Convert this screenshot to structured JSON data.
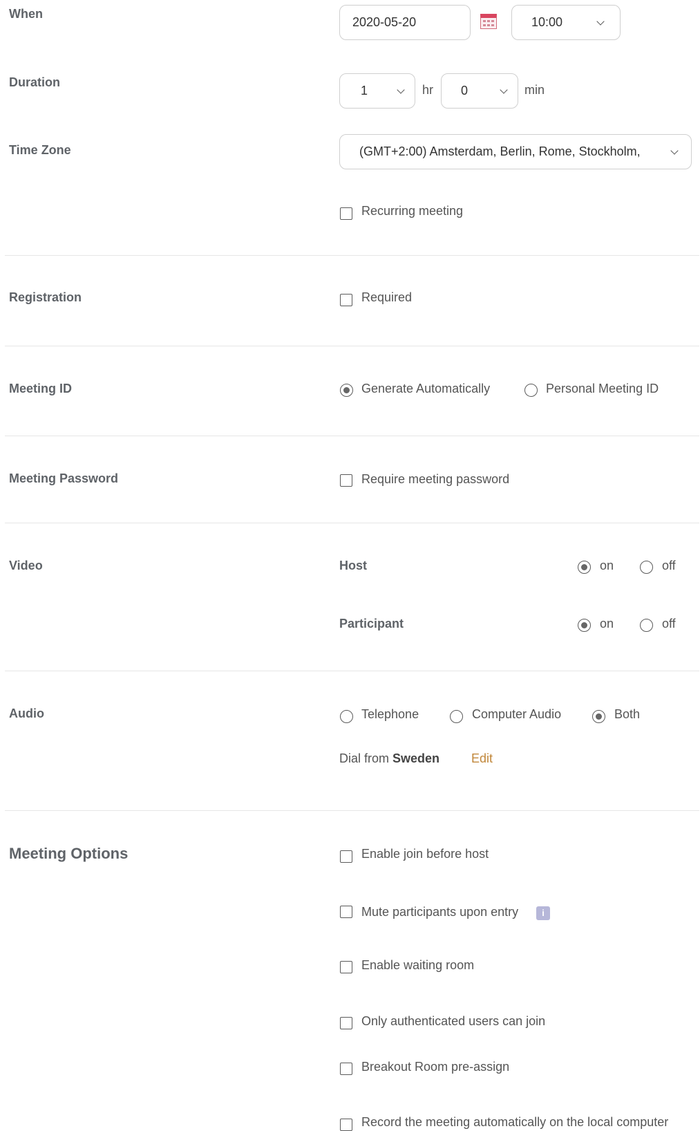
{
  "when": {
    "label": "When",
    "date": "2020-05-20",
    "time": "10:00",
    "calendar_icon": "calendar-icon"
  },
  "duration": {
    "label": "Duration",
    "hours": "1",
    "hours_unit": "hr",
    "minutes": "0",
    "minutes_unit": "min"
  },
  "time_zone": {
    "label": "Time Zone",
    "value": "(GMT+2:00) Amsterdam, Berlin, Rome, Stockholm,",
    "recurring_label": "Recurring meeting"
  },
  "registration": {
    "label": "Registration",
    "required_label": "Required"
  },
  "meeting_id": {
    "label": "Meeting ID",
    "options": [
      "Generate Automatically",
      "Personal Meeting ID"
    ],
    "selected": "Generate Automatically"
  },
  "password": {
    "label": "Meeting Password",
    "option_label": "Require meeting password"
  },
  "video": {
    "label": "Video",
    "host_label": "Host",
    "host_on": "on",
    "host_off": "off",
    "host_selected": "on",
    "participant_label": "Participant",
    "participant_on": "on",
    "participant_off": "off",
    "participant_selected": "on"
  },
  "audio": {
    "label": "Audio",
    "options": [
      "Telephone",
      "Computer Audio",
      "Both"
    ],
    "selected": "Both",
    "dial_prefix": "Dial from",
    "dial_country": "Sweden",
    "edit_label": "Edit"
  },
  "meeting_options": {
    "label": "Meeting Options",
    "items": [
      "Enable join before host",
      "Mute participants upon entry",
      "Enable waiting room",
      "Only authenticated users can join",
      "Breakout Room pre-assign",
      "Record the meeting automatically on the local computer"
    ],
    "info_icon": "info-icon"
  },
  "colors": {
    "label": "#5f6368",
    "link": "#c1873a",
    "border": "#cfcfcf",
    "divider": "#e6e6e6"
  }
}
